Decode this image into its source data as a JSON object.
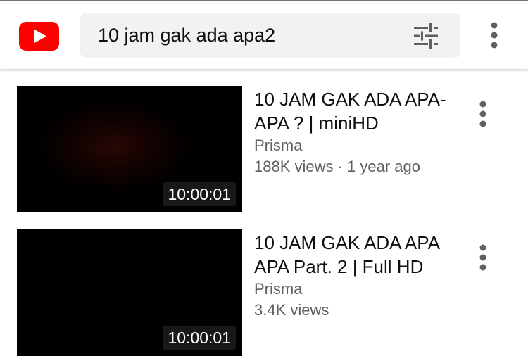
{
  "app": {
    "name": "YouTube",
    "brand_color": "#ff0000"
  },
  "search": {
    "query": "10 jam gak ada apa2",
    "filter_icon": "filter-sliders-icon",
    "more_icon": "more-vertical-icon"
  },
  "results": [
    {
      "title": "10 JAM GAK ADA APA-APA ? | miniHD",
      "channel": "Prisma",
      "meta": "188K views · 1 year ago",
      "duration": "10:00:01"
    },
    {
      "title": "10 JAM GAK ADA APA APA Part. 2 | Full HD",
      "channel": "Prisma",
      "meta": "3.4K views",
      "duration": "10:00:01"
    }
  ]
}
